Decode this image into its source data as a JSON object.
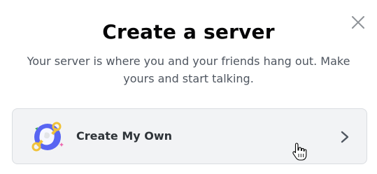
{
  "modal": {
    "title": "Create a server",
    "subtitle": "Your server is where you and your friends hang out. Make yours and start talking.",
    "option": {
      "label": "Create My Own",
      "icon": "create-server-illustration-icon"
    },
    "close_icon": "close-icon",
    "chevron_icon": "chevron-right-icon"
  },
  "colors": {
    "title": "#060607",
    "subtitle": "#4f5660",
    "option_bg": "#f2f3f5",
    "option_border": "#dadde1",
    "option_label": "#2e3338",
    "icon_blue": "#5865f2",
    "icon_yellow": "#f0c23a"
  }
}
